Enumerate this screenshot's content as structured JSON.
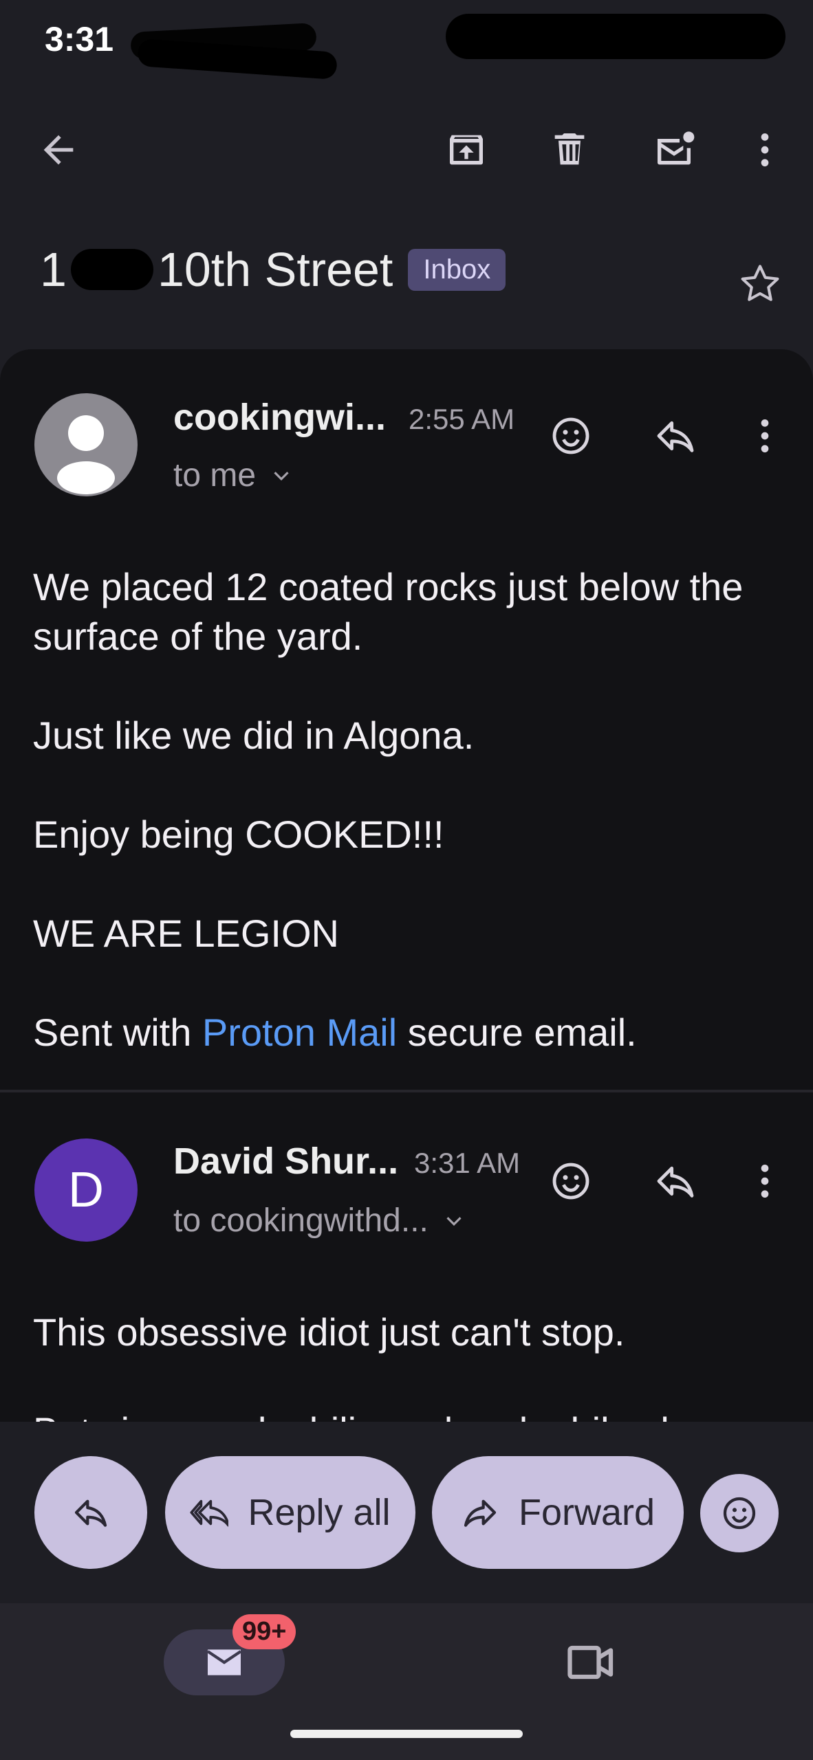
{
  "status_bar": {
    "time": "3:31"
  },
  "toolbar": {
    "back_icon": "arrow-left-icon",
    "archive_icon": "archive-icon",
    "delete_icon": "trash-icon",
    "mark_unread_icon": "mail-unread-icon",
    "more_icon": "more-vert-icon"
  },
  "thread": {
    "subject_prefix": "1",
    "subject": "10th Street",
    "label": "Inbox",
    "star_icon": "star-outline-icon"
  },
  "messages": [
    {
      "sender": "cookingwi...",
      "time": "2:55 AM",
      "to": "to me",
      "avatar_icon": "person-icon",
      "paragraphs": [
        "We placed 12 coated rocks just below the surface of the yard.",
        "Just like we did in Algona.",
        "Enjoy being COOKED!!!",
        "WE ARE LEGION"
      ],
      "footer_prefix": "Sent with ",
      "footer_link": "Proton Mail",
      "footer_suffix": " secure email."
    },
    {
      "sender": "David Shur...",
      "time": "3:31 AM",
      "to": "to cookingwithd...",
      "avatar_letter": "D",
      "avatar_color": "#5b33b0",
      "paragraphs": [
        "This obsessive idiot just can't stop.",
        "But since pedophilia and pedophiles have"
      ]
    }
  ],
  "actions": {
    "reply_icon": "reply-icon",
    "reply_all": "Reply all",
    "forward": "Forward",
    "emoji_icon": "emoji-icon"
  },
  "bottom_nav": {
    "mail_badge": "99+",
    "mail_icon": "mail-icon",
    "meet_icon": "video-icon"
  },
  "colors": {
    "background": "#1e1e24",
    "panel": "#121215",
    "pill": "#c9c1e0",
    "link": "#5a9bf6",
    "badge": "#f2616c"
  }
}
